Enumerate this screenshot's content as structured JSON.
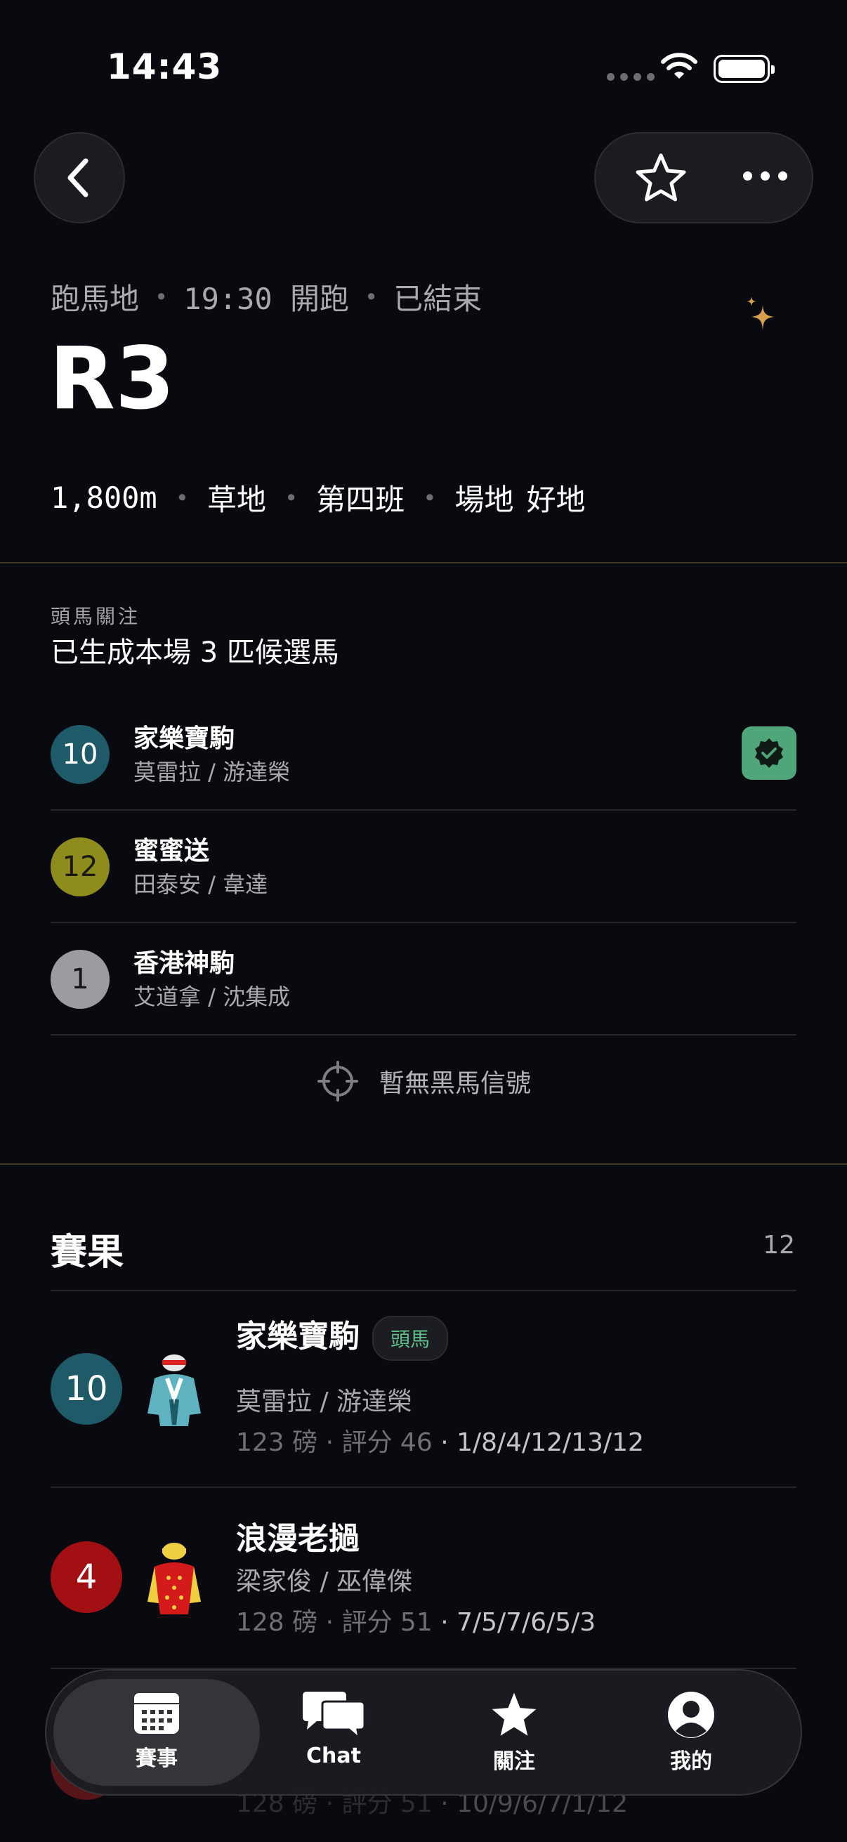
{
  "status_bar": {
    "time": "14:43"
  },
  "race": {
    "venue": "跑馬地",
    "start_time": "19:30 開跑",
    "status": "已結束",
    "title": "R3",
    "distance": "1,800m",
    "surface": "草地",
    "class": "第四班",
    "going_label": "場地",
    "going_value": "好地"
  },
  "picks_section": {
    "kicker": "頭馬關注",
    "summary": "已生成本場 3 匹候選馬",
    "items": [
      {
        "number": "10",
        "name": "家樂寶駒",
        "jockey_trainer": "莫雷拉 / 游達榮",
        "badge_color": "#1f5a68",
        "text_color": "#ffffff",
        "verified": true
      },
      {
        "number": "12",
        "name": "蜜蜜送",
        "jockey_trainer": "田泰安 / 韋達",
        "badge_color": "#8d8c1c",
        "text_color": "#1a1a10",
        "verified": false
      },
      {
        "number": "1",
        "name": "香港神駒",
        "jockey_trainer": "艾道拿 / 沈集成",
        "badge_color": "#9a9ca1",
        "text_color": "#15161a",
        "verified": false
      }
    ],
    "no_signal_text": "暫無黑馬信號",
    "no_signal_icon": "crosshair-icon"
  },
  "results_section": {
    "title": "賽果",
    "count": "12",
    "items": [
      {
        "number": "10",
        "name": "家樂寶駒",
        "tag": "頭馬",
        "jockey_trainer": "莫雷拉 / 游達榮",
        "weight_rating": "123 磅 · 評分 46",
        "recent_form": "· 1/8/4/12/13/12",
        "badge_color": "#1f5a68",
        "silk": "teal-silk"
      },
      {
        "number": "4",
        "name": "浪漫老撾",
        "jockey_trainer": "梁家俊 / 巫偉傑",
        "weight_rating": "128 磅 · 評分 51",
        "recent_form": "· 7/5/7/6/5/3",
        "badge_color": "#a21013",
        "silk": "red-yellow-silk"
      },
      {
        "number": "",
        "name": "",
        "jockey_trainer": "",
        "weight_rating": "128 磅 · 評分 51",
        "recent_form": "· 10/9/6/7/1/12",
        "badge_color": "#7a1a1c",
        "silk": ""
      }
    ]
  },
  "tab_bar": {
    "tabs": [
      {
        "label": "賽事",
        "icon": "calendar-icon",
        "active": true
      },
      {
        "label": "Chat",
        "icon": "chat-icon",
        "active": false
      },
      {
        "label": "關注",
        "icon": "star-icon",
        "active": false
      },
      {
        "label": "我的",
        "icon": "profile-icon",
        "active": false
      }
    ]
  },
  "colors": {
    "background": "#090a0f",
    "accent_gold": "#d4a14a",
    "verified_green": "#4ea67a",
    "tag_green": "#5fbf8a"
  }
}
